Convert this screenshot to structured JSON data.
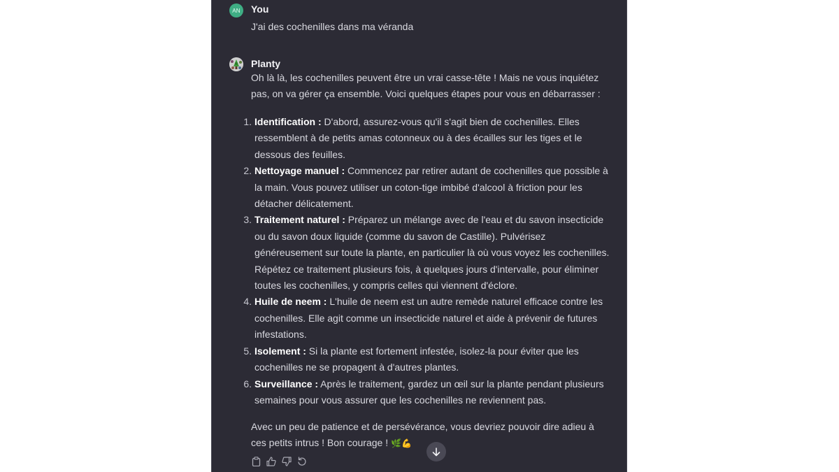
{
  "conversation": {
    "user": {
      "avatar_initials": "AN",
      "author": "You",
      "message": "J'ai des cochenilles dans ma véranda"
    },
    "assistant": {
      "author": "Planty",
      "intro": "Oh là là, les cochenilles peuvent être un vrai casse-tête ! Mais ne vous inquiétez pas, on va gérer ça ensemble. Voici quelques étapes pour vous en débarrasser :",
      "steps": [
        {
          "number": "1.",
          "title": "Identification :",
          "text": " D'abord, assurez-vous qu'il s'agit bien de cochenilles. Elles ressemblent à de petits amas cotonneux ou à des écailles sur les tiges et le dessous des feuilles."
        },
        {
          "number": "2.",
          "title": "Nettoyage manuel :",
          "text": " Commencez par retirer autant de cochenilles que possible à la main. Vous pouvez utiliser un coton-tige imbibé d'alcool à friction pour les détacher délicatement."
        },
        {
          "number": "3.",
          "title": "Traitement naturel :",
          "text": " Préparez un mélange avec de l'eau et du savon insecticide ou du savon doux liquide (comme du savon de Castille). Pulvérisez généreusement sur toute la plante, en particulier là où vous voyez les cochenilles. Répétez ce traitement plusieurs fois, à quelques jours d'intervalle, pour éliminer toutes les cochenilles, y compris celles qui viennent d'éclore."
        },
        {
          "number": "4.",
          "title": "Huile de neem :",
          "text": " L'huile de neem est un autre remède naturel efficace contre les cochenilles. Elle agit comme un insecticide naturel et aide à prévenir de futures infestations."
        },
        {
          "number": "5.",
          "title": "Isolement :",
          "text": " Si la plante est fortement infestée, isolez-la pour éviter que les cochenilles ne se propagent à d'autres plantes."
        },
        {
          "number": "6.",
          "title": "Surveillance :",
          "text": " Après le traitement, gardez un œil sur la plante pendant plusieurs semaines pour vous assurer que les cochenilles ne reviennent pas."
        }
      ],
      "outro": "Avec un peu de patience et de persévérance, vous devriez pouvoir dire adieu à ces petits intrus ! Bon courage ! ",
      "outro_emojis": "🌿💪"
    }
  },
  "actions": {
    "copy": "copy-icon",
    "thumbs_up": "thumbs-up-icon",
    "thumbs_down": "thumbs-down-icon",
    "regenerate": "regenerate-icon"
  },
  "scroll_down": "arrow-down-icon",
  "colors": {
    "panel_bg": "#2c2b35",
    "user_avatar": "#3fae84",
    "text": "#d9d9e0"
  }
}
